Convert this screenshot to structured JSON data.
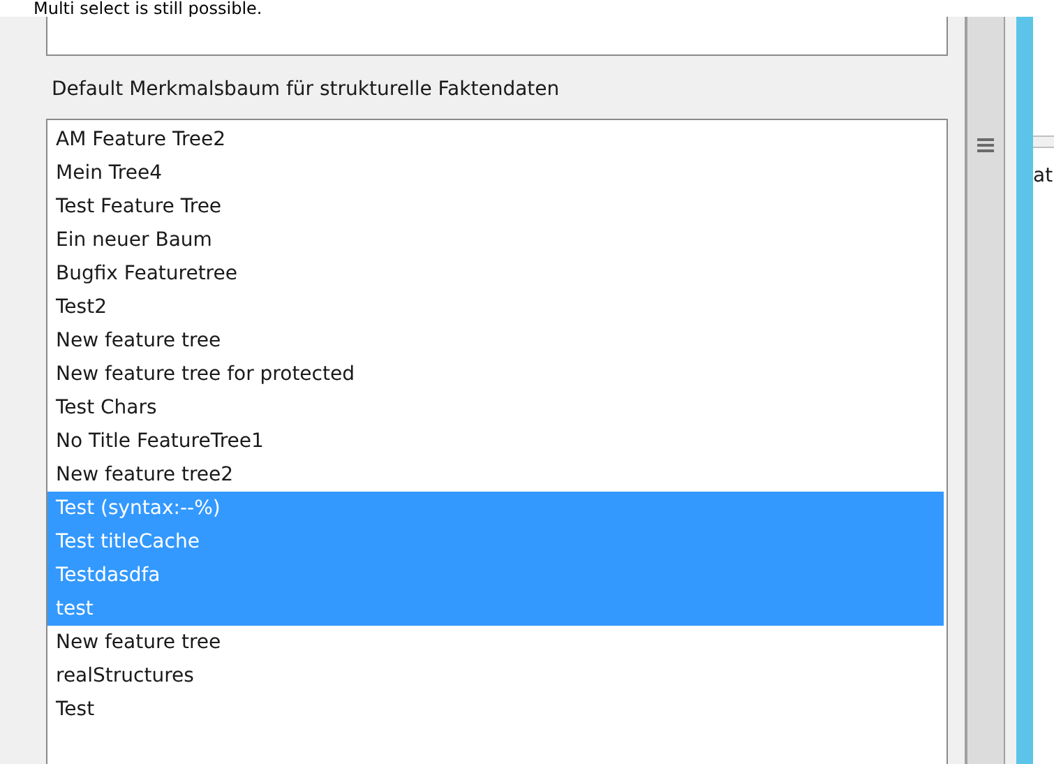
{
  "note": "Multi select is still possible.",
  "list_label": "Default Merkmalsbaum für strukturelle Faktendaten",
  "items": [
    {
      "label": "AM Feature Tree2",
      "selected": false
    },
    {
      "label": "Mein Tree4",
      "selected": false
    },
    {
      "label": "Test Feature Tree",
      "selected": false
    },
    {
      "label": "Ein neuer Baum",
      "selected": false
    },
    {
      "label": "Bugfix Featuretree",
      "selected": false
    },
    {
      "label": "Test2",
      "selected": false
    },
    {
      "label": "New feature tree",
      "selected": false
    },
    {
      "label": "New feature tree for protected",
      "selected": false
    },
    {
      "label": "Test Chars",
      "selected": false
    },
    {
      "label": "No Title FeatureTree1",
      "selected": false
    },
    {
      "label": "New feature tree2",
      "selected": false
    },
    {
      "label": "Test (syntax:--%)",
      "selected": true
    },
    {
      "label": "Test titleCache",
      "selected": true
    },
    {
      "label": "Testdasdfa",
      "selected": true
    },
    {
      "label": "test",
      "selected": true
    },
    {
      "label": "New feature tree",
      "selected": false
    },
    {
      "label": "realStructures",
      "selected": false
    },
    {
      "label": "Test",
      "selected": false
    }
  ],
  "right_panel": {
    "text": "at"
  }
}
